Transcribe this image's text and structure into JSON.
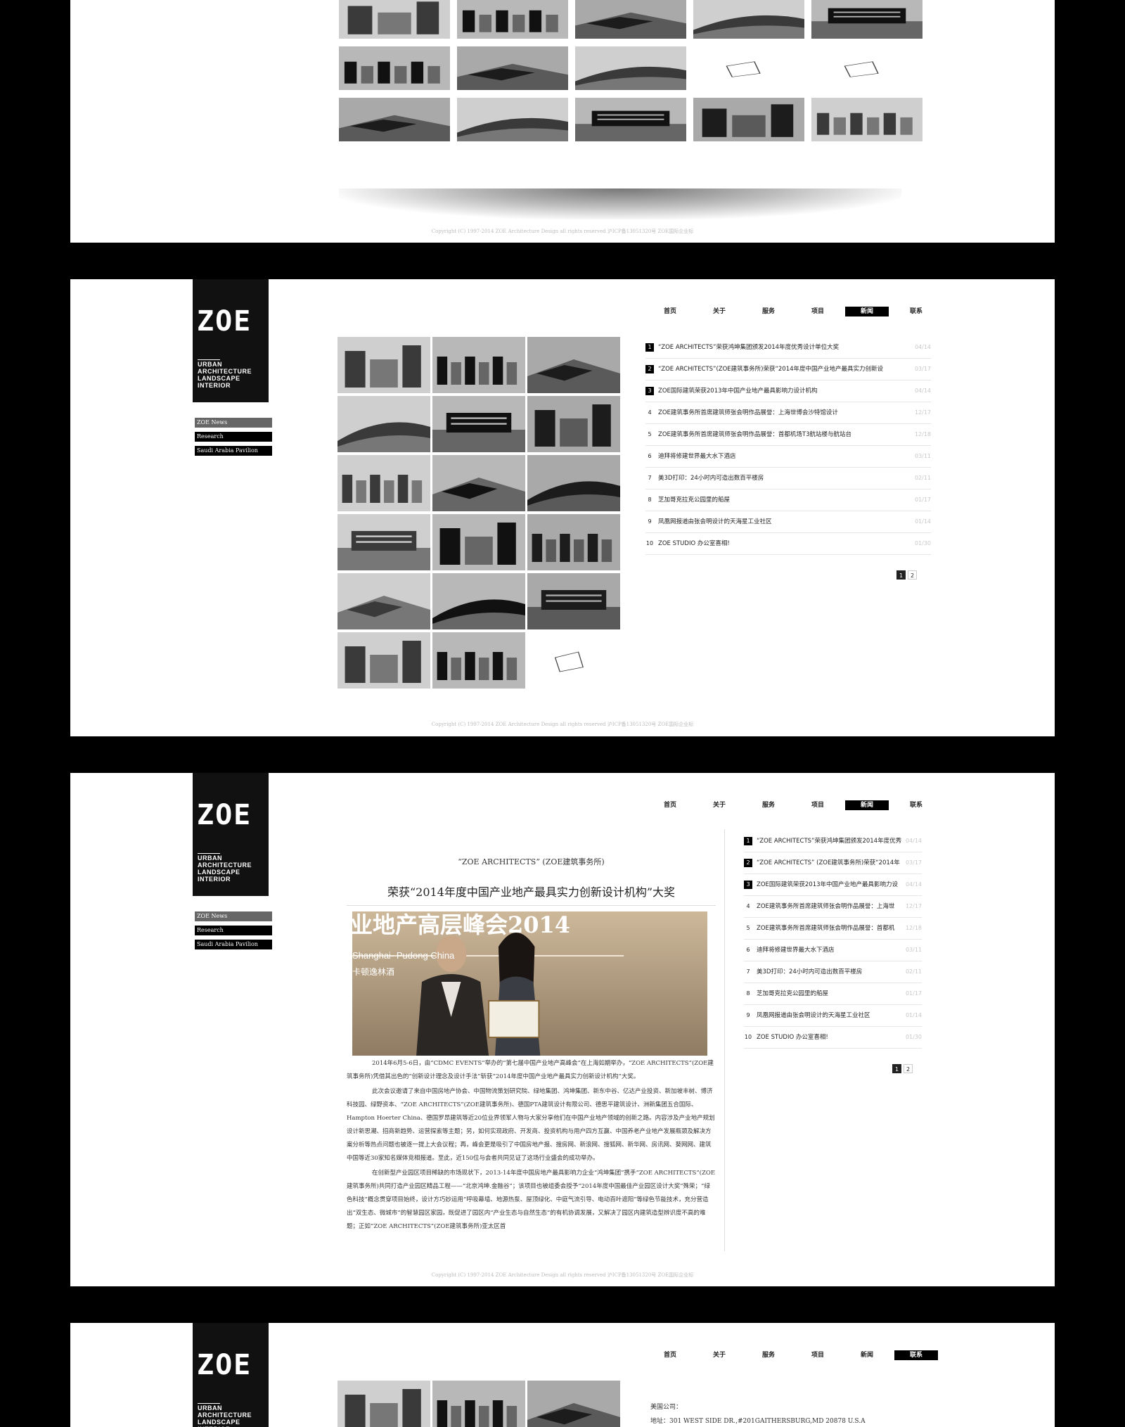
{
  "logo": {
    "mark": "ZOE",
    "tagline": [
      "URBAN",
      "ARCHITECTURE",
      "LANDSCAPE",
      "INTERIOR"
    ]
  },
  "nav": {
    "items": [
      "首页",
      "关于",
      "服务",
      "项目",
      "新闻",
      "联系"
    ]
  },
  "sidebar": {
    "items": [
      "ZOE News",
      "Research",
      "Saudi Arabia Pavilion"
    ]
  },
  "footer": {
    "text": "Copyright (C) 1997-2014 ZOE Architecture Design all rights reserved  沪ICP备13051320号 ZOE国际企业标"
  },
  "news": {
    "items": [
      {
        "num": "1",
        "title": "“ZOE ARCHITECTS”荣获鸿坤集团颁发2014年度优秀设计单位大奖",
        "date": "04/14"
      },
      {
        "num": "2",
        "title": "“ZOE ARCHITECTS”(ZOE建筑事务所)荣获“2014年度中国产业地产最具实力创新设",
        "date": "03/17"
      },
      {
        "num": "3",
        "title": "ZOE国际建筑荣获2013年中国产业地产最具影响力设计机构",
        "date": "04/14"
      },
      {
        "num": "4",
        "title": "ZOE建筑事务所首席建筑师张会明作品展誉：上海世博会沙特馆设计",
        "date": "12/17"
      },
      {
        "num": "5",
        "title": "ZOE建筑事务所首席建筑师张会明作品展誉：首都机场T3航站楼与航站台",
        "date": "12/18"
      },
      {
        "num": "6",
        "title": "迪拜将修建世界最大水下酒店",
        "date": "03/11"
      },
      {
        "num": "7",
        "title": "美3D打印：24小时内可造出数百平楼房",
        "date": "02/11"
      },
      {
        "num": "8",
        "title": "芝加哥克拉克公园里的船屋",
        "date": "01/17"
      },
      {
        "num": "9",
        "title": "凤凰网报道由张会明设计的天海星工业社区",
        "date": "01/14"
      },
      {
        "num": "10",
        "title": "ZOE STUDIO 办公室喜相!",
        "date": "01/30"
      }
    ],
    "pages": [
      "1",
      "2"
    ]
  },
  "news_short": {
    "items": [
      {
        "num": "1",
        "title": "“ZOE ARCHITECTS”荣获鸿坤集团颁发2014年度优秀",
        "date": "04/14"
      },
      {
        "num": "2",
        "title": "“ZOE ARCHITECTS” (ZOE建筑事务所)荣获“2014年",
        "date": "03/17"
      },
      {
        "num": "3",
        "title": "ZOE国际建筑荣获2013年中国产业地产最具影响力设",
        "date": "04/14"
      },
      {
        "num": "4",
        "title": "ZOE建筑事务所首席建筑师张会明作品展誉：上海世",
        "date": "12/17"
      },
      {
        "num": "5",
        "title": "ZOE建筑事务所首席建筑师张会明作品展誉：首都机",
        "date": "12/18"
      },
      {
        "num": "6",
        "title": "迪拜将修建世界最大水下酒店",
        "date": "03/11"
      },
      {
        "num": "7",
        "title": "美3D打印：24小时内可造出数百平楼房",
        "date": "02/11"
      },
      {
        "num": "8",
        "title": "芝加哥克拉克公园里的船屋",
        "date": "01/17"
      },
      {
        "num": "9",
        "title": "凤凰网报道由张会明设计的天海星工业社区",
        "date": "01/14"
      },
      {
        "num": "10",
        "title": "ZOE STUDIO 办公室喜相!",
        "date": "01/30"
      }
    ]
  },
  "article": {
    "source": "“ZOE ARCHITECTS” (ZOE建筑事务所)",
    "title": "荣获“2014年度中国产业地产最具实力创新设计机构”大奖",
    "photo_banner": "业地产高层峰会2014",
    "photo_sub": "Shanghai- Pudong China",
    "photo_sub2": "卡顿逸林酒",
    "paragraphs": [
      "2014年6月5-6日，由“CDMC EVENTS”举办的“第七届中国产业地产高峰会”在上海如期举办，“ZOE ARCHITECTS”(ZOE建筑事务所)凭借其出色的“创新设计理念及设计手法”斩获“2014年度中国产业地产最具实力创新设计机构”大奖。",
      "此次会议邀请了来自中国房地产协会、中国物流策划研究院、绿地集团、鸿坤集团、新东中谷、亿达产业投资、新加坡丰树、博济科技园、绿野资本、“ZOE ARCHITECTS”(ZOE建筑事务所)、德国PTA建筑设计有限公司、德思平建筑设计、洲新集团五合国际、Hampton Hoerter China、德国罗昂建筑等近20位业界领军人物与大家分享他们在中国产业地产领域的创新之路。内容涉及产业地产规划设计新思潮、招商新趋势、运营探索等主题；另，如何实现政府、开发商、投资机构与用户四方互赢、中国养老产业地产发展瓶颈及解决方案分析等热点问题也被逐一提上大会议程；再，峰会更是吸引了中国房地产报、搜房网、新浪网、搜狐网、新华网、房讯网、葵网网、建筑中国等近30家知名媒体竞相报道。至此，近150位与会者共同见证了这场行业盛会的成功举办。",
      "在创新型产业园区项目稀缺的市场现状下，2013-14年度中国房地产最具影响力企业“鸿坤集团”携手“ZOE ARCHITECTS”(ZOE建筑事务所)共同打造产业园区精品工程——“北京鸿坤.金融谷”；该项目也被组委会授予“2014年度中国最佳产业园区设计大奖”殊荣；“绿色科技”概念贯穿项目始终，设计方巧妙运用“呼吸幕墙、地源热泵、屋顶绿化、中庭气流引导、电动百叶遮阳”等绿色节能技术，充分营造出“双生态、微城市”的智慧园区家园，既促进了园区内“产业生态与自然生态”的有机协调发展，又解决了园区内建筑造型辨识度不高的难题；正如“ZOE ARCHITECTS”(ZOE建筑事务所)亚太区首"
    ]
  },
  "contact": {
    "lines": [
      "美国公司：",
      "地址：301 WEST SIDE DR.,#201GAITHERSBURG,MD 20878 U.S.A"
    ]
  }
}
